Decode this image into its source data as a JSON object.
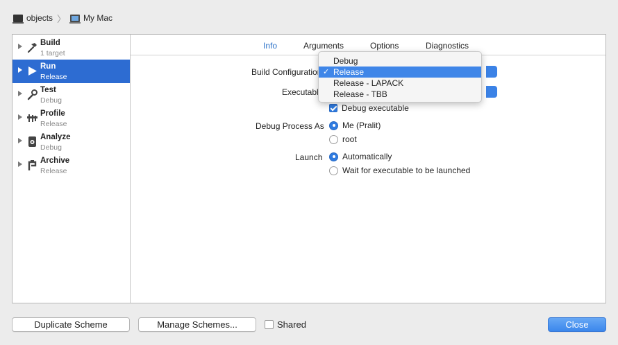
{
  "breadcrumb": {
    "project": "objects",
    "destination": "My Mac",
    "project_icon": "terminal-icon",
    "destination_icon": "mac-icon"
  },
  "sidebar": {
    "items": [
      {
        "title": "Build",
        "subtitle": "1 target",
        "icon": "hammer-icon"
      },
      {
        "title": "Run",
        "subtitle": "Release",
        "icon": "play-icon",
        "selected": true
      },
      {
        "title": "Test",
        "subtitle": "Debug",
        "icon": "wrench-icon"
      },
      {
        "title": "Profile",
        "subtitle": "Release",
        "icon": "gauge-icon"
      },
      {
        "title": "Analyze",
        "subtitle": "Debug",
        "icon": "analyze-icon"
      },
      {
        "title": "Archive",
        "subtitle": "Release",
        "icon": "archive-icon"
      }
    ]
  },
  "tabs": [
    {
      "label": "Info",
      "active": true
    },
    {
      "label": "Arguments"
    },
    {
      "label": "Options"
    },
    {
      "label": "Diagnostics"
    }
  ],
  "form": {
    "build_configuration_label": "Build Configuration",
    "executable_label": "Executable",
    "debug_executable_label": "Debug executable",
    "debug_process_as_label": "Debug Process As",
    "process_me": "Me (Pralit)",
    "process_root": "root",
    "launch_label": "Launch",
    "launch_auto": "Automatically",
    "launch_wait": "Wait for executable to be launched"
  },
  "build_config_menu": {
    "options": [
      "Debug",
      "Release",
      "Release - LAPACK",
      "Release - TBB"
    ],
    "selected": "Release",
    "check_glyph": "✓"
  },
  "footer": {
    "duplicate_label": "Duplicate Scheme",
    "manage_label": "Manage Schemes...",
    "shared_label": "Shared",
    "close_label": "Close"
  },
  "colors": {
    "accent": "#2d6cd2",
    "tab_active": "#2f74c9"
  }
}
